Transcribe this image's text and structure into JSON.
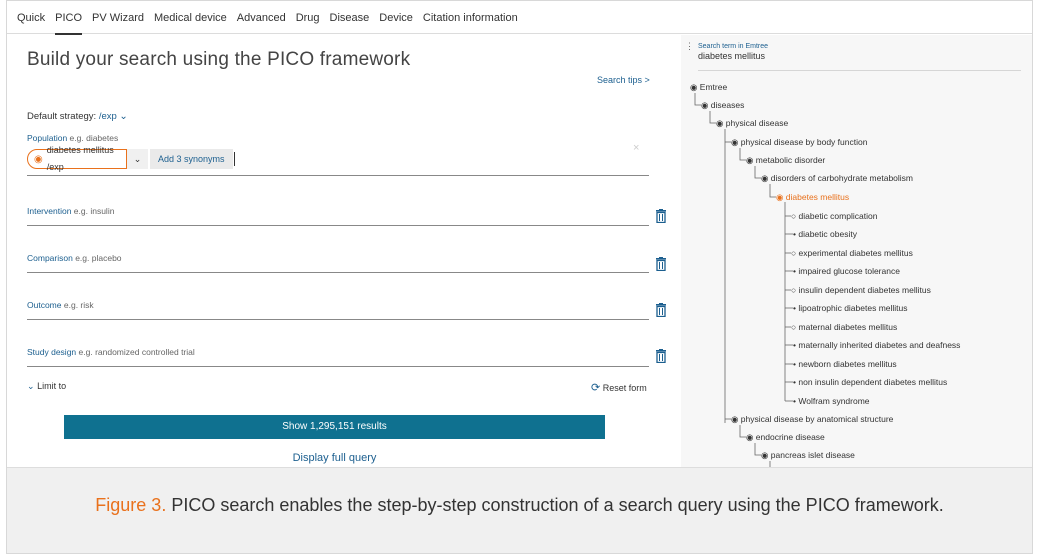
{
  "tabs": [
    {
      "label": "Quick"
    },
    {
      "label": "PICO"
    },
    {
      "label": "PV Wizard"
    },
    {
      "label": "Medical device"
    },
    {
      "label": "Advanced"
    },
    {
      "label": "Drug"
    },
    {
      "label": "Disease"
    },
    {
      "label": "Device"
    },
    {
      "label": "Citation information"
    }
  ],
  "left": {
    "title": "Build your search using the PICO framework",
    "search_tips": "Search tips >",
    "strategy_label": "Default strategy:",
    "strategy_value": "/exp",
    "population": {
      "label": "Population",
      "example": "e.g. diabetes",
      "chip": "diabetes mellitus /exp",
      "synonyms": "Add 3 synonyms"
    },
    "fields": [
      {
        "label": "Intervention",
        "example": "e.g. insulin"
      },
      {
        "label": "Comparison",
        "example": "e.g. placebo"
      },
      {
        "label": "Outcome",
        "example": "e.g. risk"
      },
      {
        "label": "Study design",
        "example": "e.g. randomized controlled trial"
      }
    ],
    "limit_to": "Limit to",
    "reset": "Reset form",
    "show_results": "Show 1,295,151 results",
    "display_query": "Display full query"
  },
  "right": {
    "head_small": "Search term in Emtree",
    "head_term": "diabetes mellitus",
    "tree": [
      {
        "label": "Emtree"
      },
      {
        "label": "diseases"
      },
      {
        "label": "physical disease"
      },
      {
        "label": "physical disease by body function"
      },
      {
        "label": "metabolic disorder"
      },
      {
        "label": "disorders of carbohydrate metabolism"
      },
      {
        "label": "diabetes mellitus"
      },
      {
        "label": "diabetic complication"
      },
      {
        "label": "diabetic obesity"
      },
      {
        "label": "experimental diabetes mellitus"
      },
      {
        "label": "impaired glucose tolerance"
      },
      {
        "label": "insulin dependent diabetes mellitus"
      },
      {
        "label": "lipoatrophic diabetes mellitus"
      },
      {
        "label": "maternal diabetes mellitus"
      },
      {
        "label": "maternally inherited diabetes and deafness"
      },
      {
        "label": "newborn diabetes mellitus"
      },
      {
        "label": "non insulin dependent diabetes mellitus"
      },
      {
        "label": "Wolfram syndrome"
      },
      {
        "label": "physical disease by anatomical structure"
      },
      {
        "label": "endocrine disease"
      },
      {
        "label": "pancreas islet disease"
      }
    ]
  },
  "caption": {
    "figure": "Figure 3.",
    "text": "PICO search enables the step-by-step construction of a search query using the PICO framework."
  },
  "colors": {
    "accent": "#e9711c",
    "link": "#1c5f8f",
    "button": "#0f7190"
  }
}
